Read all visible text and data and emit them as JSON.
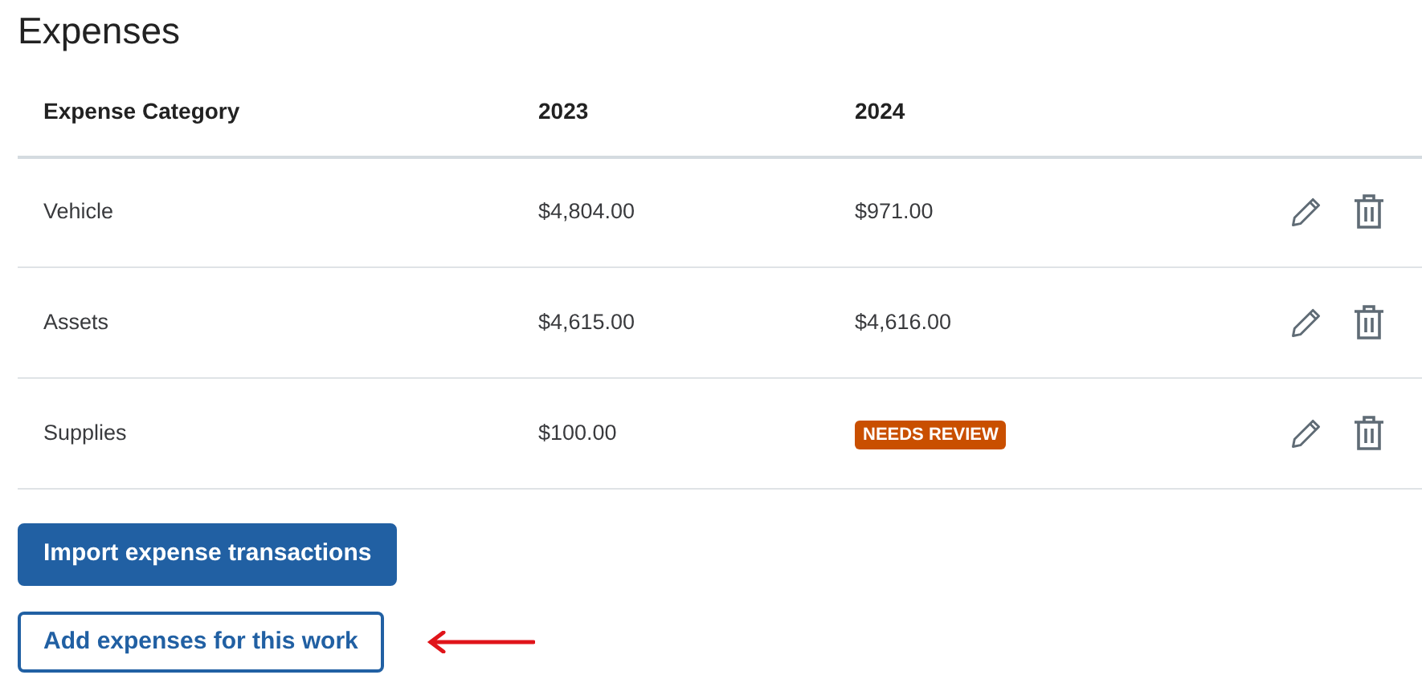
{
  "title": "Expenses",
  "table": {
    "columns": [
      "Expense Category",
      "2023",
      "2024"
    ],
    "rows": [
      {
        "cells": [
          {
            "kind": "text",
            "text": "Vehicle"
          },
          {
            "kind": "amount",
            "text": "$4,804.00"
          },
          {
            "kind": "amount",
            "text": "$971.00"
          }
        ]
      },
      {
        "cells": [
          {
            "kind": "text",
            "text": "Assets"
          },
          {
            "kind": "amount",
            "text": "$4,615.00"
          },
          {
            "kind": "amount",
            "text": "$4,616.00"
          }
        ]
      },
      {
        "cells": [
          {
            "kind": "text",
            "text": "Supplies"
          },
          {
            "kind": "amount",
            "text": "$100.00"
          },
          {
            "kind": "badge",
            "text": "NEEDS REVIEW"
          }
        ]
      }
    ]
  },
  "buttons": [
    {
      "kind": "primary",
      "label": "Import expense transactions"
    },
    {
      "kind": "outline",
      "label": "Add expenses for this work",
      "annotated": true
    }
  ]
}
